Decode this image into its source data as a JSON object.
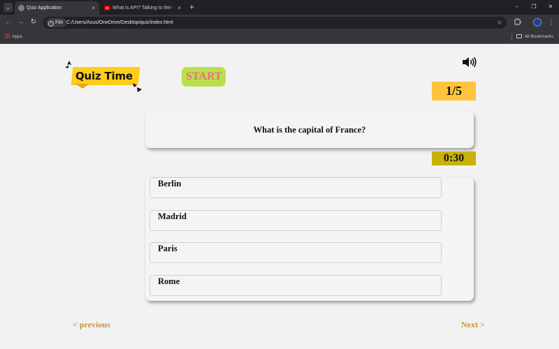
{
  "browser": {
    "tabs": [
      {
        "label": "Quiz Application",
        "active": true
      },
      {
        "label": "What is API? Talking to the Out",
        "active": false
      }
    ],
    "new_tab_symbol": "+",
    "close_symbol": "×",
    "window_controls": {
      "minimize": "–",
      "restore": "❐",
      "close": "✕"
    },
    "site_chip": "File",
    "url": "C:/Users/Asus/OneDrive/Desktop/quiz/index.html",
    "bookmarks": {
      "apps": "Apps",
      "all_bookmarks": "All Bookmarks"
    }
  },
  "quiz": {
    "logo_text": "Quiz Time",
    "logo_colors": {
      "banner": "#ffcc1a",
      "tail": "#e6a800"
    },
    "start_label": "START",
    "start_colors": {
      "background": "#b9e04c",
      "text": "#e8707a"
    },
    "counter": "1/5",
    "counter_color": "#ffc43c",
    "question": "What is the capital of France?",
    "timer": "0:30",
    "timer_color": "#c7b20a",
    "options": [
      "Berlin",
      "Madrid",
      "Paris",
      "Rome"
    ],
    "prev_label": "< previous",
    "next_label": "Next >",
    "nav_color": "#c8922b",
    "sound_icon": "speaker-volume-icon"
  }
}
